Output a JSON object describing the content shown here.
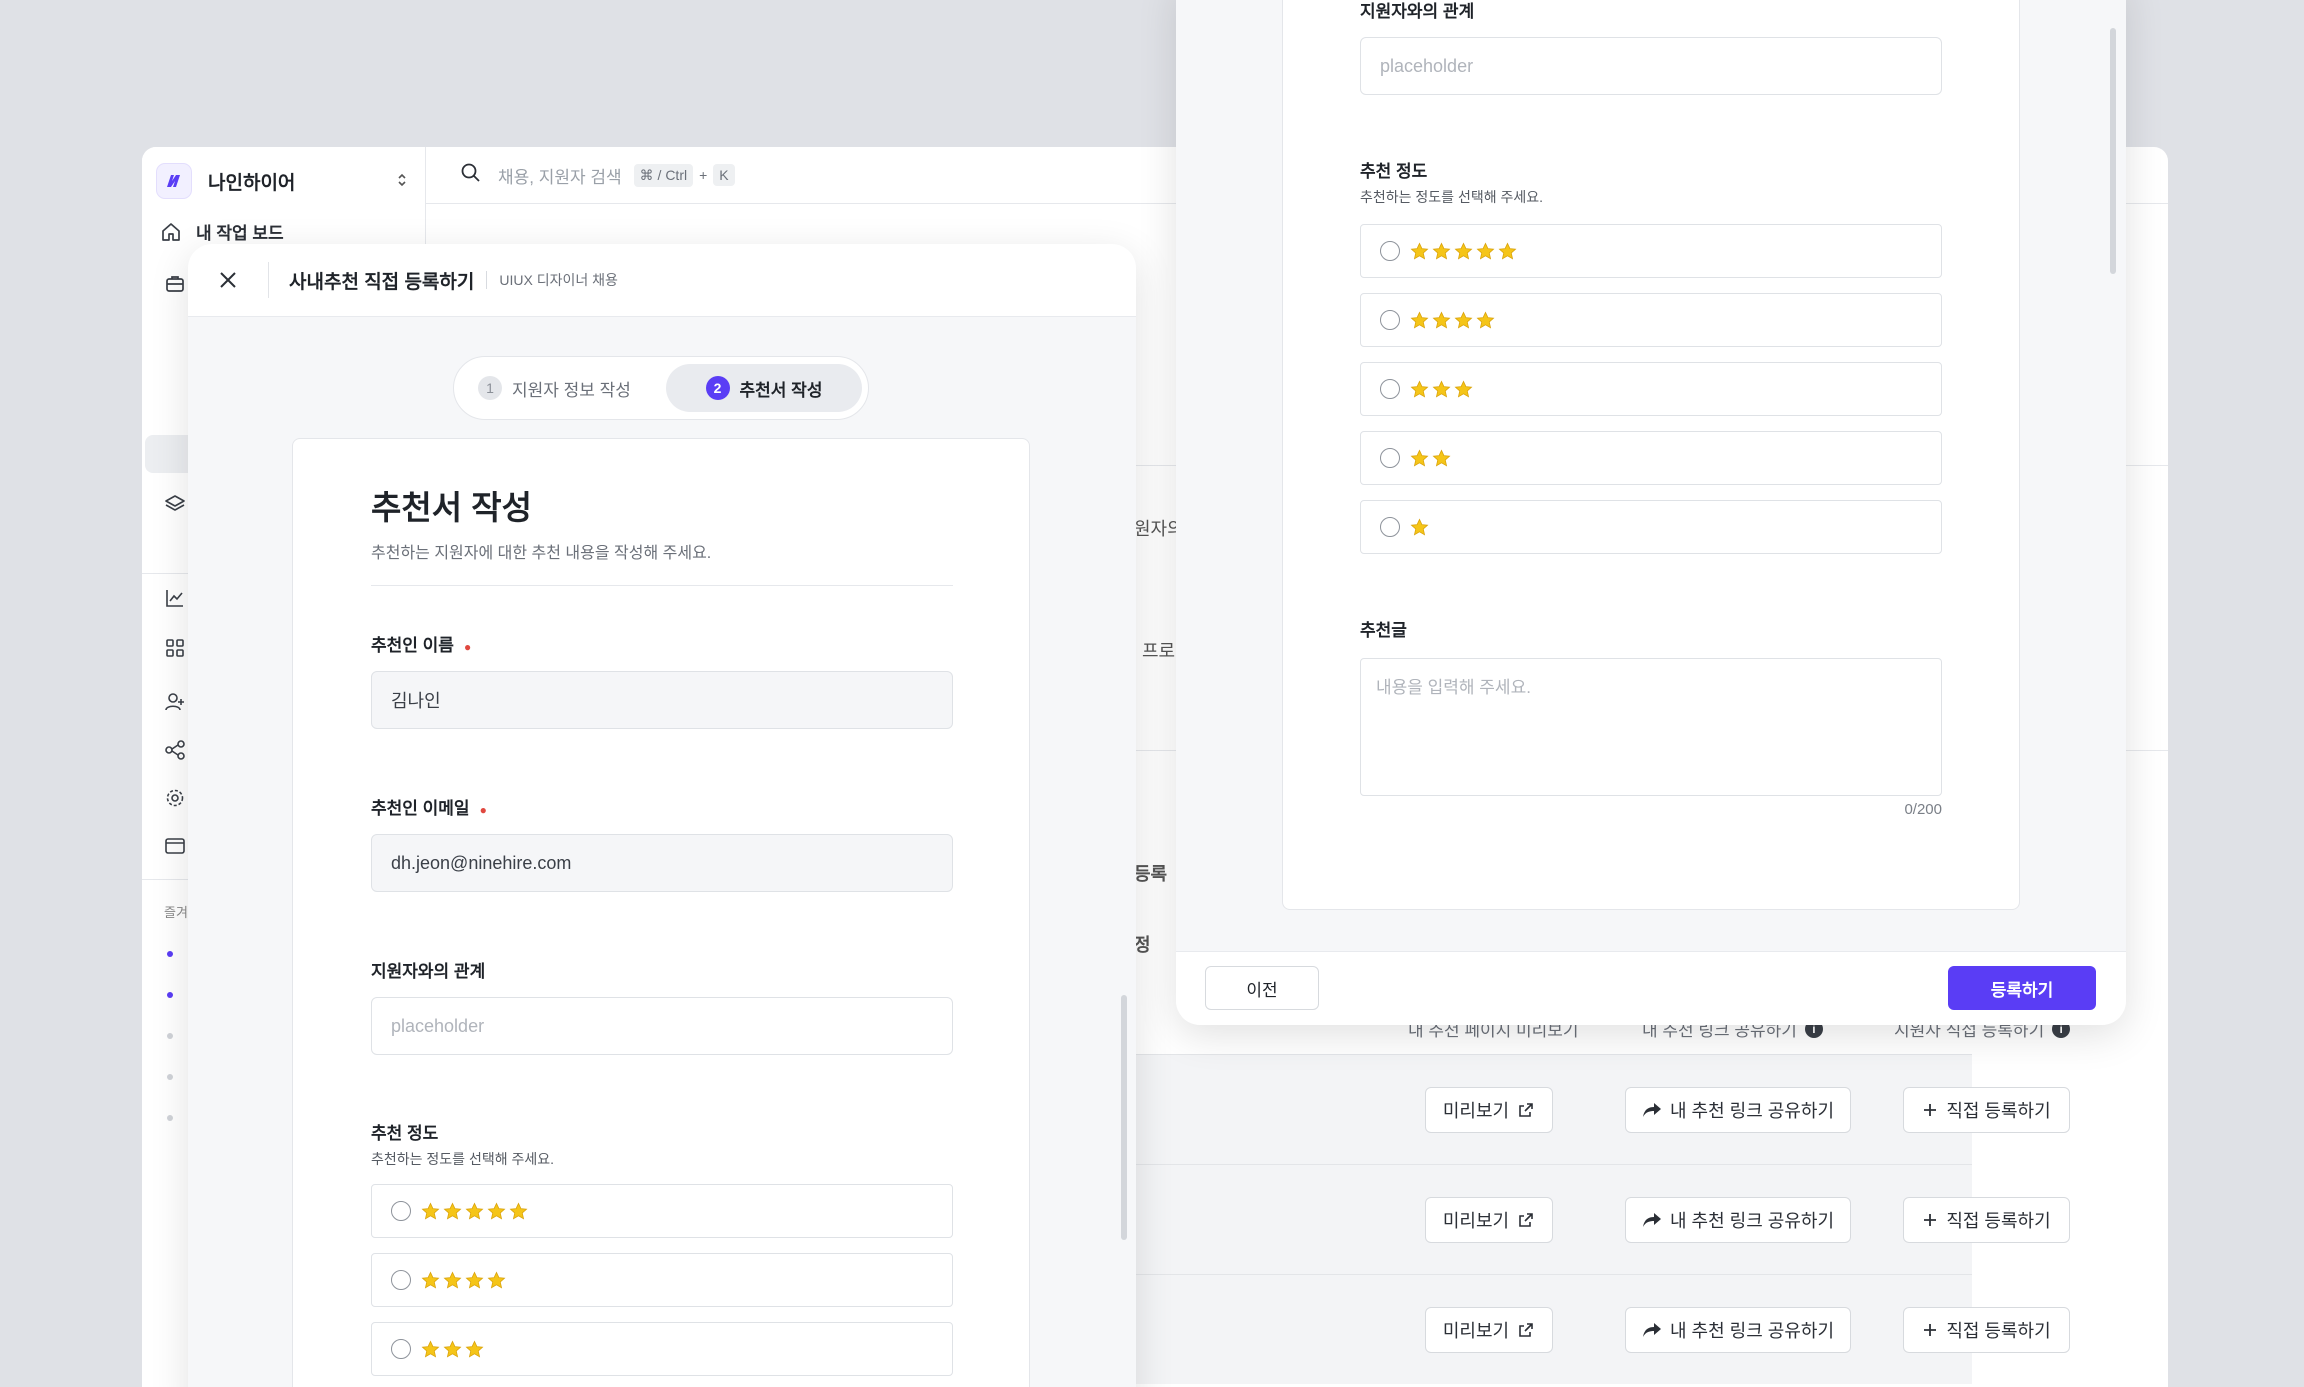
{
  "workspace": {
    "name": "나인하이어"
  },
  "sidebar": {
    "items": [
      {
        "label": "내 작업 보드",
        "icon": "home-icon"
      }
    ],
    "favorites_label": "즐겨"
  },
  "search": {
    "placeholder": "채용, 지원자 검색",
    "shortcut_mod": "⌘ / Ctrl",
    "shortcut_plus": "+",
    "shortcut_key": "K"
  },
  "background": {
    "fragments": [
      "원자의",
      "프로",
      "등록",
      "정"
    ],
    "table_headers": [
      "내 추천 페이지 미리보기",
      "내 추천 링크 공유하기",
      "지원자 직접 등록하기"
    ],
    "row_buttons": {
      "preview": "미리보기",
      "share": "내 추천 링크 공유하기",
      "register": "직접 등록하기"
    }
  },
  "modal_left": {
    "title": "사내추천 직접 등록하기",
    "subtitle": "UIUX 디자이너 채용",
    "steps": [
      {
        "num": "1",
        "label": "지원자 정보 작성"
      },
      {
        "num": "2",
        "label": "추천서 작성"
      }
    ],
    "form": {
      "title": "추천서 작성",
      "description": "추천하는 지원자에 대한 추천 내용을 작성해 주세요.",
      "name_label": "추천인 이름",
      "name_value": "김나인",
      "email_label": "추천인 이메일",
      "email_value": "dh.jeon@ninehire.com",
      "relation_label": "지원자와의 관계",
      "relation_placeholder": "placeholder",
      "rating_label": "추천 정도",
      "rating_help": "추천하는 정도를 선택해 주세요."
    }
  },
  "modal_right": {
    "relation_label": "지원자와의 관계",
    "relation_placeholder": "placeholder",
    "rating_label": "추천 정도",
    "rating_help": "추천하는 정도를 선택해 주세요.",
    "recommend_label": "추천글",
    "recommend_placeholder": "내용을 입력해 주세요.",
    "counter": "0/200",
    "prev_label": "이전",
    "submit_label": "등록하기"
  },
  "rating_options": [
    5,
    4,
    3,
    2,
    1
  ],
  "colors": {
    "accent": "#5a3df5",
    "required": "#e0483f",
    "star": "#f5c518"
  }
}
